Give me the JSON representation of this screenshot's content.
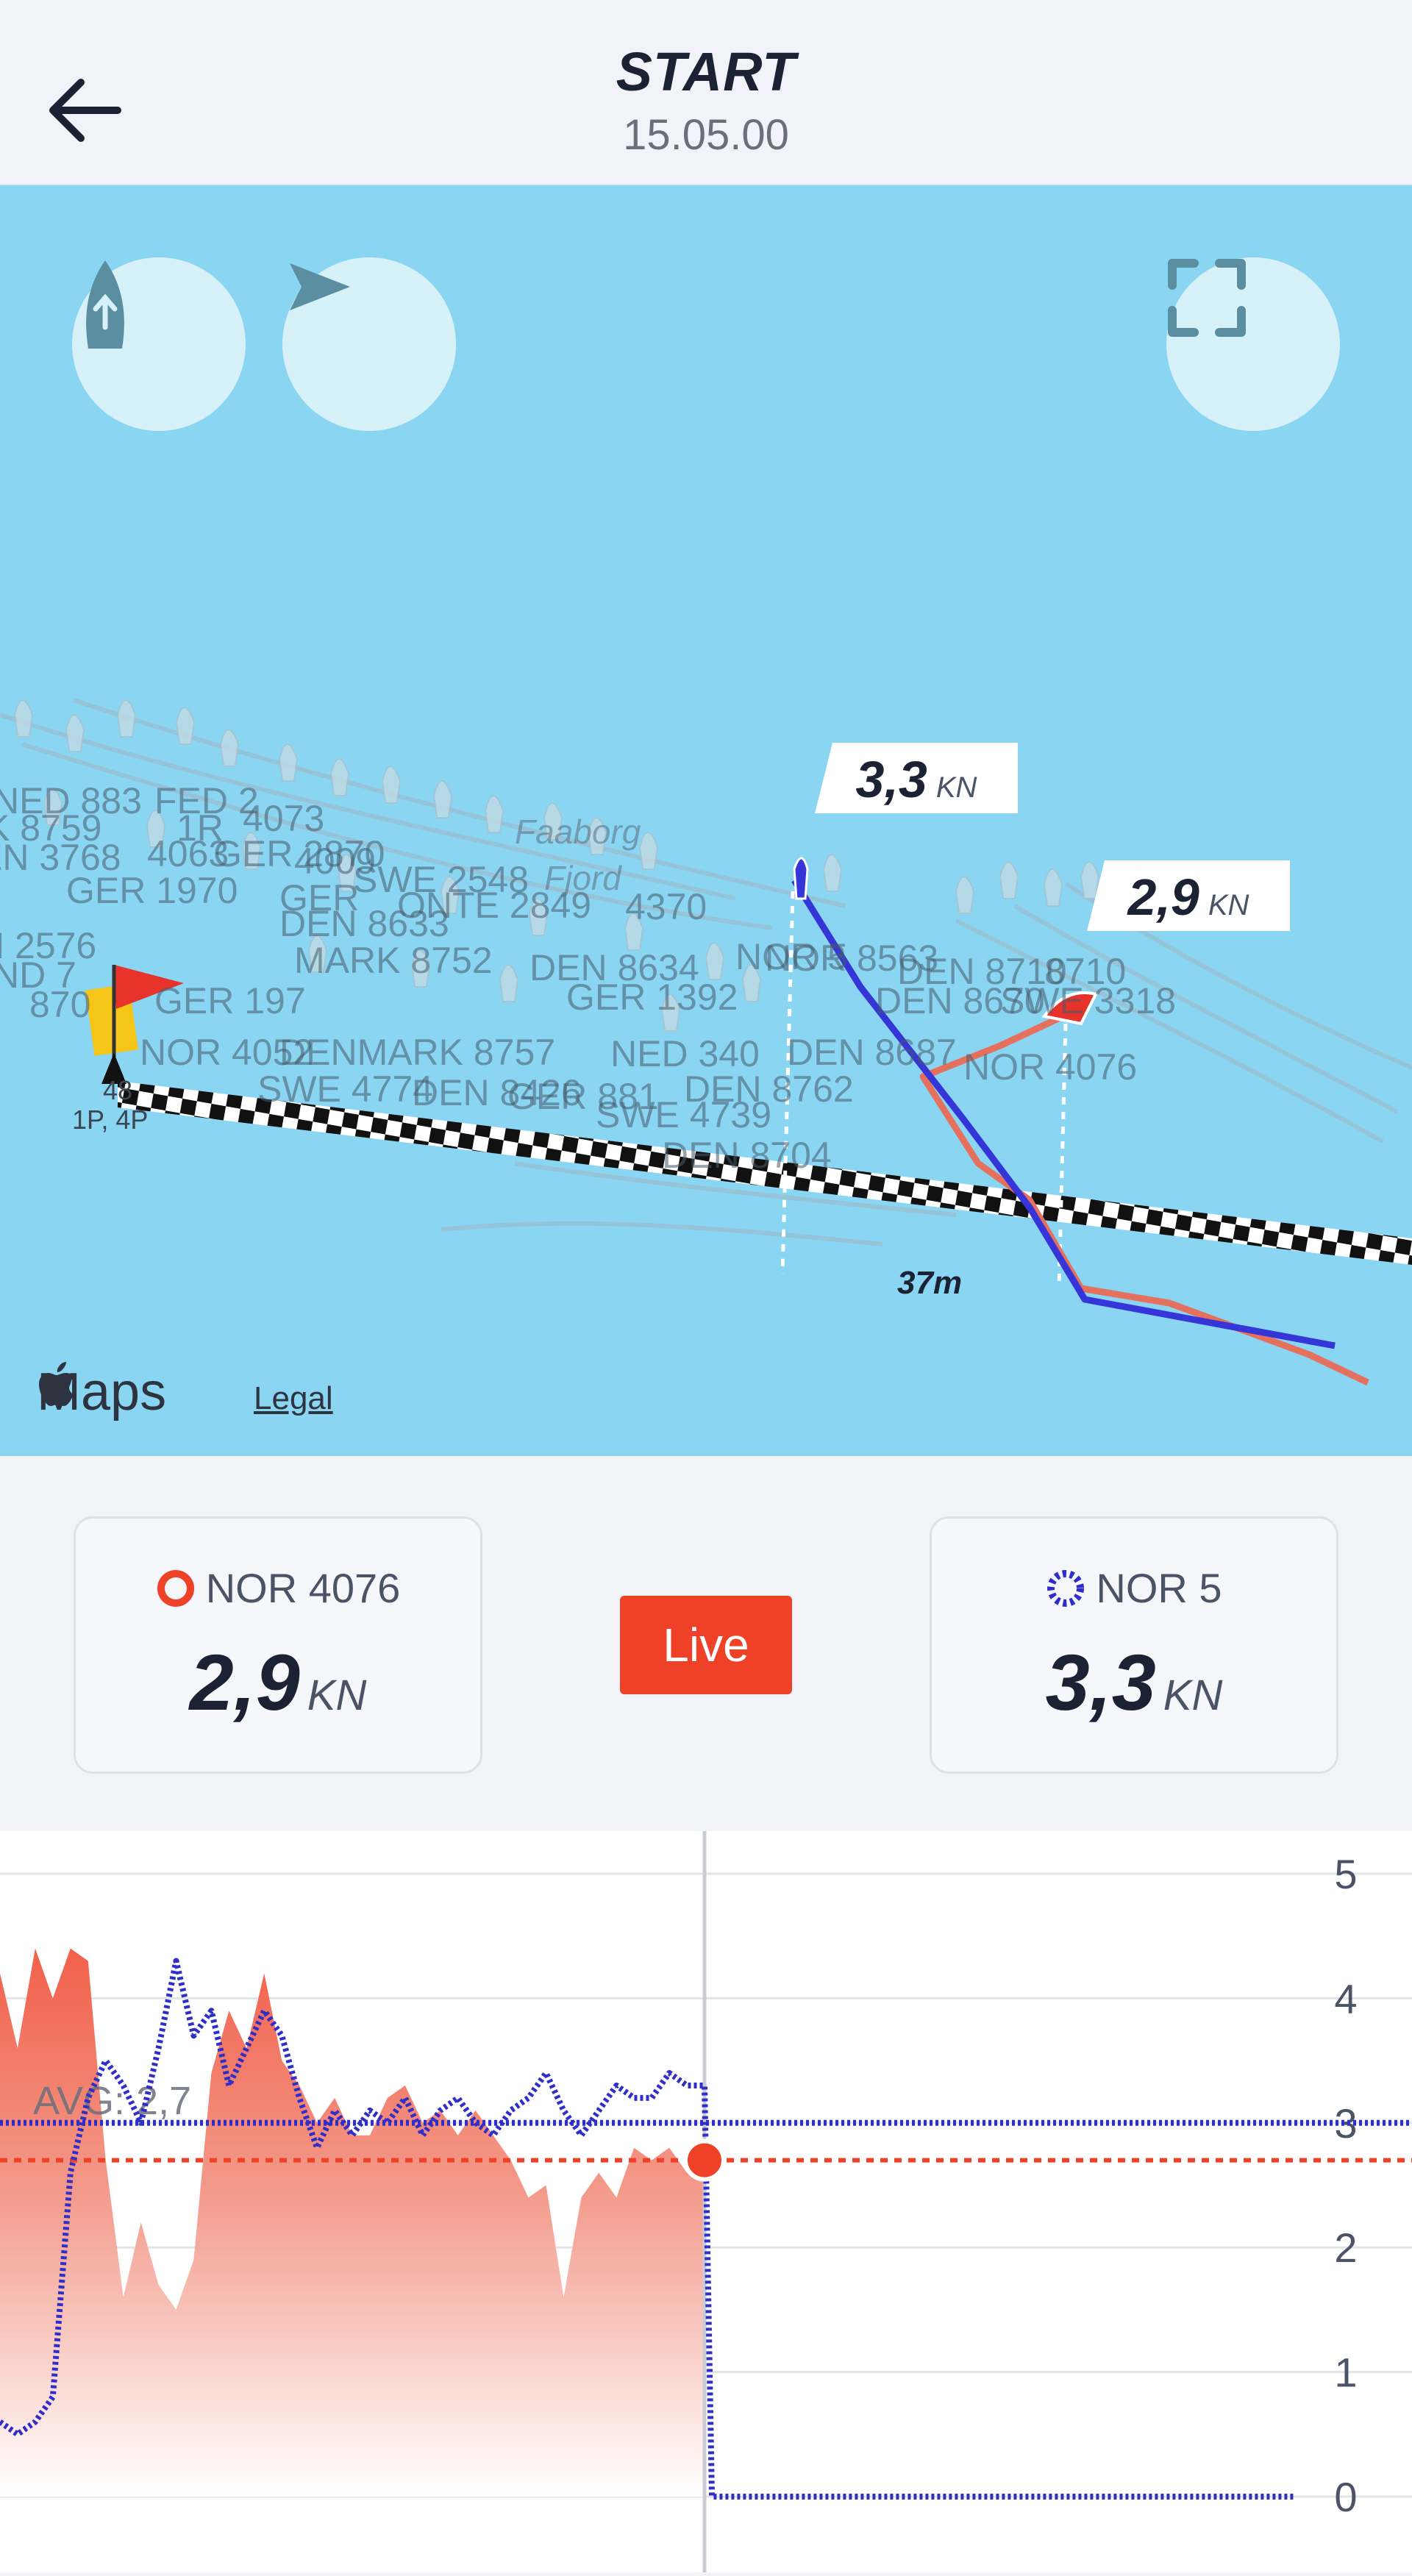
{
  "header": {
    "title": "START",
    "subtitle": "15.05.00"
  },
  "map": {
    "buttons": [
      "boat-heading-mode",
      "course-up-mode",
      "fullscreen"
    ],
    "tag_left": {
      "value": "3,3",
      "unit": "KN"
    },
    "tag_right": {
      "value": "2,9",
      "unit": "KN"
    },
    "place_label_1": "Faaborg",
    "place_label_2": "Fjord",
    "distance_label": "37m",
    "pin_label": "1P, 4P",
    "pin_number": "48",
    "attribution": "Maps",
    "legal": "Legal",
    "boat_labels": [
      "NED 883",
      "FED 2",
      "4073",
      "K 8759",
      "1R",
      "EN 3768",
      "4063",
      "4009",
      "GER 2870",
      "SWE 2548",
      "GER 1970",
      "GER",
      "ONTE 2849",
      "4370",
      "DEN 8633",
      "N 2576",
      "MARK 8752",
      "DEN 8634",
      "NOR 5",
      "GER 1392",
      "DEN 8710",
      "NOR 8563",
      "8710",
      "DEN 8670",
      "SWE 3318",
      "ND 7",
      "870",
      "GER 197",
      "NOR 4076",
      "NOR 4052",
      "DENMARK 8757",
      "NED 340",
      "DEN 8687",
      "SWE 4774",
      "DEN 8426",
      "GER 881",
      "DEN 8762",
      "SWE 4739",
      "DEN 8704"
    ]
  },
  "left_boat": {
    "name": "NOR 4076",
    "speed": "2,9",
    "unit": "KN"
  },
  "right_boat": {
    "name": "NOR 5",
    "speed": "3,3",
    "unit": "KN"
  },
  "live_label": "Live",
  "chart_data": {
    "type": "area",
    "ylim": [
      0,
      5
    ],
    "yticks": [
      "0",
      "1",
      "2",
      "3",
      "4",
      "5"
    ],
    "avg_label": "AVG: 2,7",
    "avg_values": {
      "NOR 4076": 2.7,
      "NOR 5": 3.0
    },
    "current_index": 40,
    "series": [
      {
        "name": "NOR 4076",
        "color": "#ee4127",
        "style": "area",
        "values": [
          4.2,
          3.6,
          4.4,
          4.0,
          4.4,
          4.3,
          2.7,
          1.6,
          2.2,
          1.7,
          1.5,
          1.9,
          3.4,
          3.9,
          3.6,
          4.2,
          3.5,
          3.3,
          3.0,
          3.2,
          2.9,
          2.9,
          3.2,
          3.3,
          3.0,
          3.1,
          2.9,
          3.1,
          2.9,
          2.7,
          2.4,
          2.5,
          1.6,
          2.4,
          2.6,
          2.4,
          2.8,
          2.7,
          2.8,
          2.6,
          2.7
        ]
      },
      {
        "name": "NOR 5",
        "color": "#2f2fc8",
        "style": "dotted",
        "values": [
          0.6,
          0.5,
          0.6,
          0.8,
          2.6,
          3.2,
          3.5,
          3.3,
          3.0,
          3.6,
          4.3,
          3.7,
          3.9,
          3.3,
          3.6,
          3.9,
          3.7,
          3.2,
          2.8,
          3.1,
          2.9,
          3.1,
          3.0,
          3.2,
          2.9,
          3.1,
          3.2,
          3.0,
          2.9,
          3.1,
          3.2,
          3.4,
          3.1,
          2.9,
          3.1,
          3.3,
          3.2,
          3.2,
          3.4,
          3.3,
          3.3
        ]
      }
    ]
  }
}
